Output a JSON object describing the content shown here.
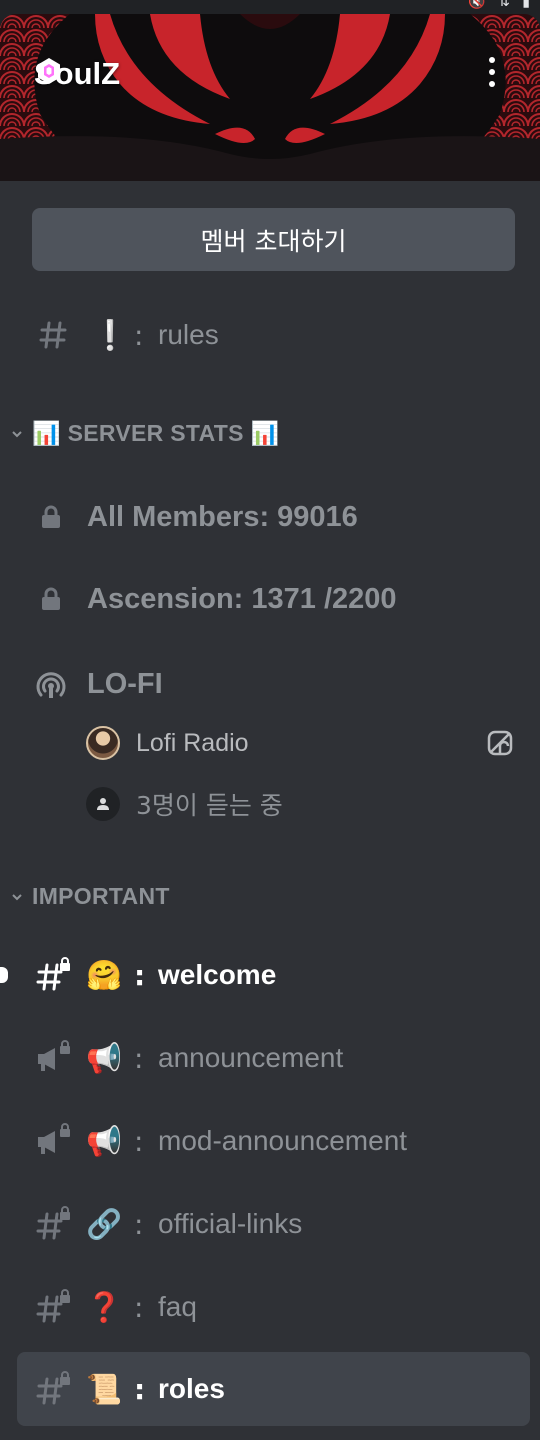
{
  "server": {
    "name": "SoulZ",
    "invite_label": "멤버 초대하기"
  },
  "top_channel": {
    "emoji": "❕",
    "sep": ":",
    "name": "rules"
  },
  "categories": {
    "stats": {
      "label": "📊 SERVER STATS 📊"
    },
    "important": {
      "label": "IMPORTANT"
    }
  },
  "stats_channels": [
    {
      "name": "All Members: 99016"
    },
    {
      "name": "Ascension: 1371 /2200"
    }
  ],
  "stage": {
    "name": "LO-FI",
    "speaker": "Lofi Radio",
    "listeners": "3명이 듣는 중"
  },
  "channels": [
    {
      "type": "text",
      "emoji": "🤗",
      "sep": ":",
      "name": "welcome",
      "state": "unread"
    },
    {
      "type": "announcement",
      "emoji": "📢",
      "sep": ":",
      "name": "announcement",
      "state": "read"
    },
    {
      "type": "announcement",
      "emoji": "📢",
      "sep": ":",
      "name": "mod-announcement",
      "state": "read"
    },
    {
      "type": "text",
      "emoji": "🔗",
      "sep": ":",
      "name": "official-links",
      "state": "read"
    },
    {
      "type": "text",
      "emoji": "❓",
      "sep": ":",
      "name": "faq",
      "state": "read"
    },
    {
      "type": "text",
      "emoji": "📜",
      "sep": ":",
      "name": "roles",
      "state": "selected"
    }
  ],
  "colors": {
    "background": "#2f3136",
    "muted_text": "#8e9297",
    "active_text": "#ffffff",
    "button": "#4f545c",
    "selected_row": "#40444b",
    "banner_red": "#c8242b"
  }
}
